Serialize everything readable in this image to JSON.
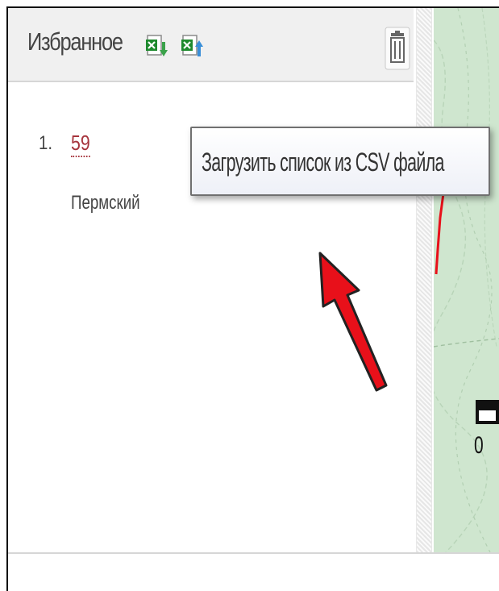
{
  "favorites": {
    "title": "Избранное",
    "download_icon": "excel-download-icon",
    "upload_icon": "excel-upload-icon",
    "trash_icon": "trash-icon",
    "items": [
      {
        "number": "1.",
        "link": "59",
        "subtitle": "Пермский"
      }
    ]
  },
  "tooltip": {
    "text": "Загрузить список из CSV файла"
  },
  "map": {
    "scale_zero": "0"
  },
  "colors": {
    "link": "#a6343c",
    "arrow": "#e8101a",
    "map_bg": "#cfe6cf"
  }
}
